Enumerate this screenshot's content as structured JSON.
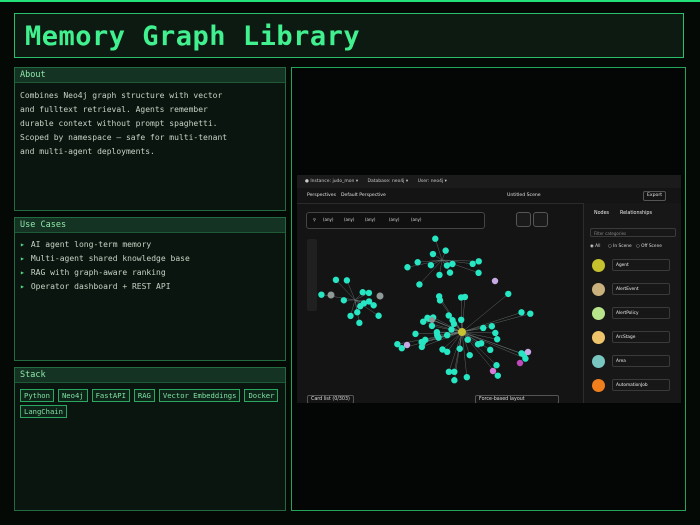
{
  "header": {
    "title": "Memory Graph Library"
  },
  "about": {
    "title": "About",
    "text": "Combines Neo4j graph structure with vector\nand fulltext retrieval. Agents remember\ndurable context without prompt spaghetti.\nScoped by namespace — safe for multi-tenant\nand multi-agent deployments."
  },
  "use_cases": {
    "title": "Use Cases",
    "items": [
      "AI agent long-term memory",
      "Multi-agent shared knowledge base",
      "RAG with graph-aware ranking",
      "Operator dashboard + REST API"
    ]
  },
  "stack": {
    "title": "Stack",
    "tags": [
      "Python",
      "Neo4j",
      "FastAPI",
      "RAG",
      "Vector Embeddings",
      "Docker",
      "LangChain"
    ]
  },
  "screenshot": {
    "topbar": {
      "instance": "● Instance: judo_mon ▾",
      "database": "Database: neo4j ▾",
      "user": "User: neo4j ▾"
    },
    "perspectives_label": "Perspectives",
    "default_perspective": "Default Perspective",
    "scene_title": "Untitled Scene",
    "export_label": "Export",
    "search_chips": [
      "(any)",
      "(any)",
      "(any)",
      "(any)",
      "(any)"
    ],
    "sidebar": {
      "tab_nodes": "Nodes",
      "tab_relationships": "Relationships",
      "filter_placeholder": "Filter categories",
      "radio_all": "All",
      "radio_in_scene": "In Scene",
      "radio_off_scene": "Off Scene",
      "categories": [
        {
          "name": "Agent",
          "color": "#c5c22d"
        },
        {
          "name": "AlertEvent",
          "color": "#c9b07d"
        },
        {
          "name": "AlertPolicy",
          "color": "#b8e58c"
        },
        {
          "name": "ArcStage",
          "color": "#f0c46a"
        },
        {
          "name": "Area",
          "color": "#79c6c0"
        },
        {
          "name": "AutomationJob",
          "color": "#f07e1d"
        }
      ]
    },
    "card_list": "Card list (0/303)",
    "layout_label": "Force-based layout",
    "colors": {
      "node": "#27e6c3",
      "hub": "#c8c232",
      "grey": "#8f9a98",
      "pink": "#d67ad8",
      "magenta": "#c04ab9",
      "lavender": "#c7a9e5"
    }
  }
}
